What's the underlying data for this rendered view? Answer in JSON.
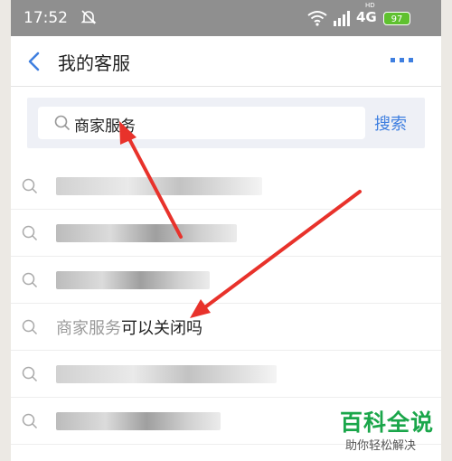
{
  "status_bar": {
    "time": "17:52",
    "network": "4G",
    "hd": "HD",
    "battery": "97",
    "icons": [
      "do-not-disturb-icon",
      "wifi-icon",
      "signal-icon",
      "battery-icon"
    ]
  },
  "header": {
    "title": "我的客服",
    "icons": [
      "back-icon",
      "more-icon"
    ]
  },
  "search": {
    "query": "商家服务",
    "button_label": "搜索"
  },
  "suggestions": [
    {
      "text": "",
      "obscured": true
    },
    {
      "text": "",
      "obscured": true
    },
    {
      "text": "",
      "obscured": true
    },
    {
      "match": "商家服务",
      "rest": "可以关闭吗",
      "obscured": false
    },
    {
      "text": "",
      "obscured": true
    },
    {
      "text": "",
      "obscured": true
    }
  ],
  "watermark": {
    "title": "百科全说",
    "subtitle": "助你轻松解决"
  },
  "colors": {
    "accent": "#3f7fe0",
    "status_bar": "#8f8f8f",
    "annotation_arrow": "#e8322b",
    "watermark_green": "#1aa64a"
  }
}
